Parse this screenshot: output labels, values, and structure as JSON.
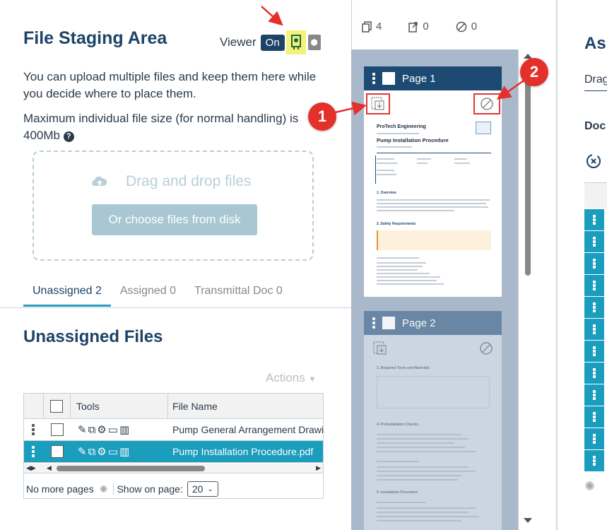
{
  "staging": {
    "title": "File Staging Area",
    "viewer_label": "Viewer",
    "viewer_toggle": "On",
    "description": "You can upload multiple files and keep them here while you decide where to place them.",
    "max_size": "Maximum individual file size (for normal handling) is 400Mb",
    "drop_text": "Drag and drop files",
    "choose_button": "Or choose files from disk",
    "tabs": [
      {
        "label": "Unassigned 2",
        "active": true
      },
      {
        "label": "Assigned 0",
        "active": false
      },
      {
        "label": "Transmittal Doc 0",
        "active": false
      }
    ],
    "section_title": "Unassigned Files",
    "actions_label": "Actions",
    "grid": {
      "headers": [
        "Tools",
        "File Name"
      ],
      "rows": [
        {
          "file_name": "Pump General Arrangement Drawin",
          "selected": false
        },
        {
          "file_name": "Pump Installation Procedure.pdf",
          "selected": true
        }
      ],
      "no_more": "No more pages",
      "show_on_page_label": "Show on page:",
      "show_on_page_value": "20"
    }
  },
  "viewer": {
    "stats": [
      {
        "icon": "copy-pages-icon",
        "value": "4"
      },
      {
        "icon": "export-icon",
        "value": "0"
      },
      {
        "icon": "excluded-icon",
        "value": "0"
      }
    ],
    "pages": [
      {
        "label": "Page 1",
        "doc": {
          "company": "ProTech Engineering",
          "title": "Pump Installation Procedure",
          "sections": [
            "1. Overview",
            "2. Safety Requirements"
          ]
        }
      },
      {
        "label": "Page 2",
        "doc": {
          "sections": [
            "3. Required Tools and Materials",
            "4. Preinstallation Checks",
            "5. Installation Procedure"
          ]
        }
      }
    ]
  },
  "right_panel": {
    "title": "As",
    "subtitle": "Drag",
    "doc_label": "Doc"
  },
  "annotations": {
    "badge_1": "1",
    "badge_2": "2"
  },
  "colors": {
    "brand": "#1d4366",
    "accent": "#1b9dbd",
    "callout": "#e4302b",
    "highlight": "#f4f27a"
  }
}
